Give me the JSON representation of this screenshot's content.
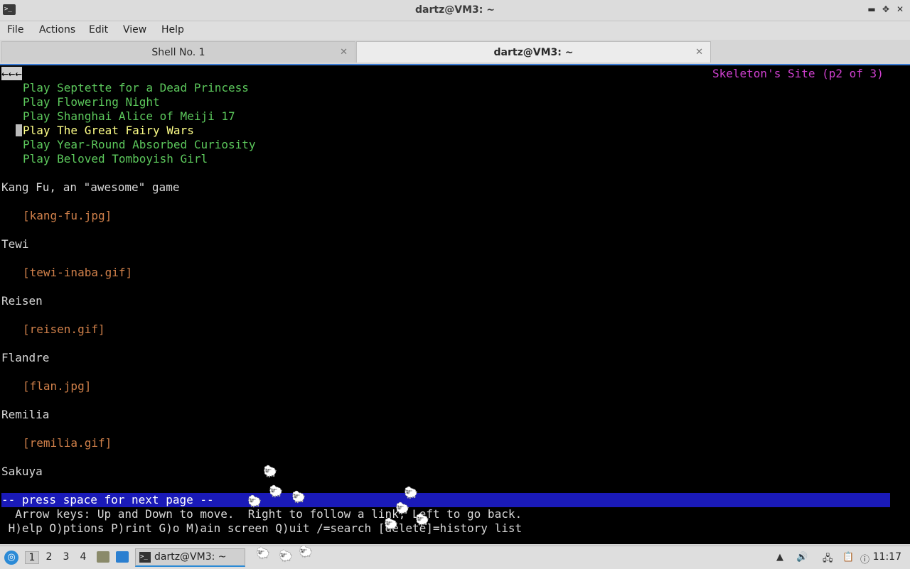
{
  "window": {
    "title": "dartz@VM3: ~",
    "icon_label": ">_",
    "minimize": "▬",
    "maximize": "✥",
    "close": "✕"
  },
  "menu": [
    "File",
    "Actions",
    "Edit",
    "View",
    "Help"
  ],
  "tabs": [
    {
      "label": "Shell No. 1",
      "close": "✕"
    },
    {
      "label": "dartz@VM3: ~",
      "close": "✕"
    }
  ],
  "terminal": {
    "back_arrows": "←←←",
    "page_title": "Skeleton's Site (p2 of 3)",
    "links": [
      "Play Septette for a Dead Princess",
      "Play Flowering Night",
      "Play Shanghai Alice of Meiji 17",
      "Play The Great Fairy Wars",
      "Play Year-Round Absorbed Curiosity",
      "Play Beloved Tomboyish Girl"
    ],
    "entries": [
      {
        "name": "Kang Fu, an \"awesome\" game",
        "image": "[kang-fu.jpg]"
      },
      {
        "name": "Tewi",
        "image": "[tewi-inaba.gif]"
      },
      {
        "name": "Reisen",
        "image": "[reisen.gif]"
      },
      {
        "name": "Flandre",
        "image": "[flan.jpg]"
      },
      {
        "name": "Remilia",
        "image": "[remilia.gif]"
      }
    ],
    "last_entry": "Sakuya",
    "status": "-- press space for next page --",
    "help1": "  Arrow keys: Up and Down to move.  Right to follow a link; Left to go back.",
    "help2": " H)elp O)ptions P)rint G)o M)ain screen Q)uit /=search [delete]=history list"
  },
  "taskbar": {
    "start_icon": "start-menu-icon",
    "workspaces": [
      "1",
      "2",
      "3",
      "4"
    ],
    "task_label": "dartz@VM3: ~",
    "clock": "11:17"
  }
}
